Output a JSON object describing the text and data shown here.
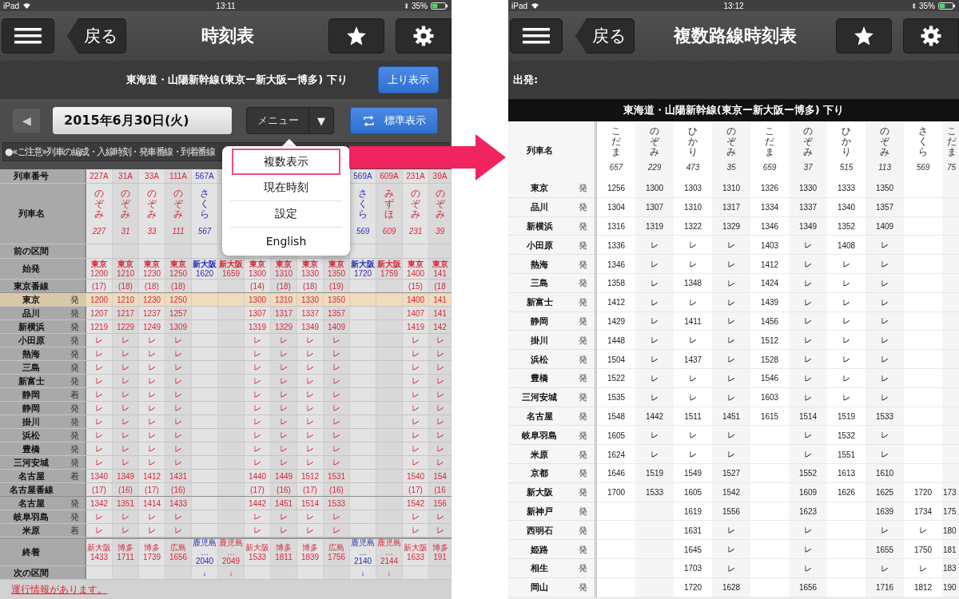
{
  "left_screen": {
    "status_bar": {
      "device": "iPad",
      "time": "13:11",
      "battery": "35%"
    },
    "nav": {
      "back": "戻る",
      "title": "時刻表"
    },
    "route_bar": {
      "title": "東海道・山陽新幹線(東京ー新大阪ー博多) 下り",
      "button": "上り表示"
    },
    "date_bar": {
      "prev": "◀",
      "date": "2015年6月30日(火)",
      "menu": "メニュー",
      "menu_caret": "▼",
      "view_button": "標準表示"
    },
    "notice": "●«ご注意»列車の編成・入線時刻・発車番線・到着番線",
    "menu_popup": {
      "items": [
        {
          "label": "複数表示",
          "selected": true
        },
        {
          "label": "現在時刻",
          "selected": false
        },
        {
          "label": "設定",
          "selected": false
        },
        {
          "label": "English",
          "selected": false
        }
      ]
    },
    "table": {
      "header_labels": {
        "number": "列車番号",
        "name": "列車名",
        "previous": "前の区間",
        "origin": "始発",
        "terminal": "終着",
        "next": "次の区間"
      },
      "rows": [
        {
          "label": "東京番線",
          "kind": "track",
          "highlight": false
        },
        {
          "label": "東京",
          "mark": "発",
          "kind": "stop",
          "highlight": true
        },
        {
          "label": "品川",
          "mark": "発",
          "kind": "stop",
          "highlight": false
        },
        {
          "label": "新横浜",
          "mark": "発",
          "kind": "stop",
          "highlight": false
        },
        {
          "label": "小田原",
          "mark": "発",
          "kind": "stop",
          "highlight": false
        },
        {
          "label": "熱海",
          "mark": "発",
          "kind": "stop",
          "highlight": false
        },
        {
          "label": "三島",
          "mark": "発",
          "kind": "stop",
          "highlight": false
        },
        {
          "label": "新富士",
          "mark": "発",
          "kind": "stop",
          "highlight": false
        },
        {
          "label": "静岡",
          "mark": "着",
          "kind": "stop",
          "highlight": false
        },
        {
          "label": "静岡",
          "mark": "発",
          "kind": "stop",
          "highlight": false
        },
        {
          "label": "掛川",
          "mark": "発",
          "kind": "stop",
          "highlight": false
        },
        {
          "label": "浜松",
          "mark": "発",
          "kind": "stop",
          "highlight": false
        },
        {
          "label": "豊橋",
          "mark": "発",
          "kind": "stop",
          "highlight": false
        },
        {
          "label": "三河安城",
          "mark": "発",
          "kind": "stop",
          "highlight": false
        },
        {
          "label": "名古屋",
          "mark": "着",
          "kind": "stop",
          "highlight": false
        },
        {
          "label": "名古屋番線",
          "kind": "track",
          "highlight": false
        },
        {
          "label": "名古屋",
          "mark": "発",
          "kind": "stop",
          "highlight": false
        },
        {
          "label": "岐阜羽島",
          "mark": "発",
          "kind": "stop",
          "highlight": false
        },
        {
          "label": "米原",
          "mark": "着",
          "kind": "stop",
          "highlight": false
        }
      ],
      "trains": [
        {
          "number": "227A",
          "name": "のぞみ",
          "name_number": "227",
          "color": "#d42a3c",
          "origin": "東京",
          "origin_time": "1200",
          "values": [
            "(17)",
            "1200",
            "1207",
            "1219",
            "レ",
            "レ",
            "レ",
            "レ",
            "レ",
            "レ",
            "レ",
            "レ",
            "レ",
            "レ",
            "1340",
            "(17)",
            "1342",
            "レ",
            "レ"
          ],
          "terminal": "新大阪",
          "terminal_time": "1433"
        },
        {
          "number": "31A",
          "name": "のぞみ",
          "name_number": "31",
          "color": "#d42a3c",
          "origin": "東京",
          "origin_time": "1210",
          "values": [
            "(18)",
            "1210",
            "1217",
            "1229",
            "レ",
            "レ",
            "レ",
            "レ",
            "レ",
            "レ",
            "レ",
            "レ",
            "レ",
            "レ",
            "1349",
            "(16)",
            "1351",
            "レ",
            "レ"
          ],
          "terminal": "博多",
          "terminal_time": "1711"
        },
        {
          "number": "33A",
          "name": "のぞみ",
          "name_number": "33",
          "color": "#d42a3c",
          "origin": "東京",
          "origin_time": "1230",
          "values": [
            "(18)",
            "1230",
            "1237",
            "1249",
            "レ",
            "レ",
            "レ",
            "レ",
            "レ",
            "レ",
            "レ",
            "レ",
            "レ",
            "レ",
            "1412",
            "(17)",
            "1414",
            "レ",
            "レ"
          ],
          "terminal": "博多",
          "terminal_time": "1739"
        },
        {
          "number": "111A",
          "name": "のぞみ",
          "name_number": "111",
          "color": "#d42a3c",
          "origin": "東京",
          "origin_time": "1250",
          "values": [
            "(18)",
            "1250",
            "1257",
            "1309",
            "レ",
            "レ",
            "レ",
            "レ",
            "レ",
            "レ",
            "レ",
            "レ",
            "レ",
            "レ",
            "1431",
            "(16)",
            "1433",
            "レ",
            "レ"
          ],
          "terminal": "広島",
          "terminal_time": "1656"
        },
        {
          "number": "567A",
          "name": "さくら",
          "name_number": "567",
          "color": "#2b2fb4",
          "origin": "新大阪",
          "origin_time": "1620",
          "terminal": "鹿児島…",
          "terminal_time": "2040",
          "next": "↓"
        },
        {
          "color": "#d42a3c",
          "origin": "新大阪",
          "origin_time": "1659",
          "terminal": "鹿児島…",
          "terminal_time": "2049",
          "next": "↓"
        },
        {
          "color": "#d42a3c",
          "origin": "東京",
          "origin_time": "1300",
          "values": [
            "(14)",
            "1300",
            "1307",
            "1319",
            "レ",
            "レ",
            "レ",
            "レ",
            "レ",
            "レ",
            "レ",
            "レ",
            "レ",
            "レ",
            "1440",
            "(17)",
            "1442",
            "レ",
            "レ"
          ],
          "terminal": "新大阪",
          "terminal_time": "1533"
        },
        {
          "color": "#d42a3c",
          "origin": "東京",
          "origin_time": "1310",
          "values": [
            "(18)",
            "1310",
            "1317",
            "1329",
            "レ",
            "レ",
            "レ",
            "レ",
            "レ",
            "レ",
            "レ",
            "レ",
            "レ",
            "レ",
            "1449",
            "(16)",
            "1451",
            "レ",
            "レ"
          ],
          "terminal": "博多",
          "terminal_time": "1811"
        },
        {
          "color": "#d42a3c",
          "origin": "東京",
          "origin_time": "1330",
          "values": [
            "(18)",
            "1330",
            "1337",
            "1349",
            "レ",
            "レ",
            "レ",
            "レ",
            "レ",
            "レ",
            "レ",
            "レ",
            "レ",
            "レ",
            "1512",
            "(17)",
            "1514",
            "レ",
            "レ"
          ],
          "terminal": "博多",
          "terminal_time": "1839"
        },
        {
          "color": "#d42a3c",
          "origin": "東京",
          "origin_time": "1350",
          "values": [
            "(19)",
            "1350",
            "1357",
            "1409",
            "レ",
            "レ",
            "レ",
            "レ",
            "レ",
            "レ",
            "レ",
            "レ",
            "レ",
            "レ",
            "1531",
            "(16)",
            "1533",
            "レ",
            "レ"
          ],
          "terminal": "広島",
          "terminal_time": "1756"
        },
        {
          "number": "569A",
          "name": "さくら",
          "name_number": "569",
          "color": "#2b2fb4",
          "origin": "新大阪",
          "origin_time": "1720",
          "terminal": "鹿児島…",
          "terminal_time": "2140",
          "next": "↓"
        },
        {
          "number": "609A",
          "name": "みずほ",
          "name_number": "609",
          "color": "#d42a3c",
          "origin": "新大阪",
          "origin_time": "1759",
          "terminal": "鹿児島…",
          "terminal_time": "2144",
          "next": "↓"
        },
        {
          "number": "231A",
          "name": "のぞみ",
          "name_number": "231",
          "color": "#d42a3c",
          "origin": "東京",
          "origin_time": "1400",
          "values": [
            "(15)",
            "1400",
            "1407",
            "1419",
            "レ",
            "レ",
            "レ",
            "レ",
            "レ",
            "レ",
            "レ",
            "レ",
            "レ",
            "レ",
            "1540",
            "(17)",
            "1542",
            "レ",
            "レ"
          ],
          "terminal": "新大阪",
          "terminal_time": "1633"
        },
        {
          "number": "39A",
          "name": "のぞみ",
          "name_number": "39",
          "color": "#d42a3c",
          "origin": "東京",
          "origin_time": "141",
          "values": [
            "(18",
            "141",
            "141",
            "142",
            "レ",
            "レ",
            "レ",
            "レ",
            "レ",
            "レ",
            "レ",
            "レ",
            "レ",
            "レ",
            "154",
            "(16",
            "156",
            "レ",
            "レ"
          ],
          "terminal": "博多",
          "terminal_time": "191"
        }
      ]
    },
    "footer_link": "運行情報があります。"
  },
  "right_screen": {
    "status_bar": {
      "device": "iPad",
      "time": "13:12",
      "battery": "35%"
    },
    "nav": {
      "back": "戻る",
      "title": "複数路線時刻表"
    },
    "departure_label": "出発:",
    "route_title": "東海道・山陽新幹線(東京ー新大阪ー博多) 下り",
    "table": {
      "name_label": "列車名",
      "stations": [
        {
          "label": "東京",
          "mark": "発"
        },
        {
          "label": "品川",
          "mark": "発"
        },
        {
          "label": "新横浜",
          "mark": "発"
        },
        {
          "label": "小田原",
          "mark": "発"
        },
        {
          "label": "熱海",
          "mark": "発"
        },
        {
          "label": "三島",
          "mark": "発"
        },
        {
          "label": "新富士",
          "mark": "発"
        },
        {
          "label": "静岡",
          "mark": "発"
        },
        {
          "label": "掛川",
          "mark": "発"
        },
        {
          "label": "浜松",
          "mark": "発"
        },
        {
          "label": "豊橋",
          "mark": "発"
        },
        {
          "label": "三河安城",
          "mark": "発"
        },
        {
          "label": "名古屋",
          "mark": "発"
        },
        {
          "label": "岐阜羽島",
          "mark": "発"
        },
        {
          "label": "米原",
          "mark": "発"
        },
        {
          "label": "京都",
          "mark": "発"
        },
        {
          "label": "新大阪",
          "mark": "発"
        },
        {
          "label": "新神戸",
          "mark": "発"
        },
        {
          "label": "西明石",
          "mark": "発"
        },
        {
          "label": "姫路",
          "mark": "発"
        },
        {
          "label": "相生",
          "mark": "発"
        },
        {
          "label": "岡山",
          "mark": "発"
        }
      ],
      "trains": [
        {
          "name": "こだま",
          "number": "657",
          "from_bottom": false,
          "values": [
            "1256",
            "1304",
            "1316",
            "1336",
            "1346",
            "1358",
            "1412",
            "1429",
            "1448",
            "1504",
            "1522",
            "1535",
            "1548",
            "1605",
            "1624",
            "1646",
            "1700"
          ]
        },
        {
          "name": "のぞみ",
          "number": "229",
          "from_bottom": false,
          "values": [
            "1300",
            "1307",
            "1319",
            "レ",
            "レ",
            "レ",
            "レ",
            "レ",
            "レ",
            "レ",
            "レ",
            "レ",
            "1442",
            "レ",
            "レ",
            "1519",
            "1533"
          ]
        },
        {
          "name": "ひかり",
          "number": "473",
          "values": [
            "1303",
            "1310",
            "1322",
            "レ",
            "レ",
            "1348",
            "レ",
            "1411",
            "レ",
            "1437",
            "レ",
            "レ",
            "1511",
            "レ",
            "レ",
            "1549",
            "1605",
            "1619",
            "1631",
            "1645",
            "1703",
            "1720"
          ]
        },
        {
          "name": "のぞみ",
          "number": "35",
          "values": [
            "1310",
            "1317",
            "1329",
            "レ",
            "レ",
            "レ",
            "レ",
            "レ",
            "レ",
            "レ",
            "レ",
            "レ",
            "1451",
            "レ",
            "レ",
            "1527",
            "1542",
            "1556",
            "レ",
            "レ",
            "レ",
            "1628"
          ]
        },
        {
          "name": "こだま",
          "number": "659",
          "from_bottom": false,
          "values": [
            "1326",
            "1334",
            "1346",
            "1403",
            "1412",
            "1424",
            "1439",
            "1456",
            "1512",
            "1528",
            "1546",
            "1603",
            "1615"
          ]
        },
        {
          "name": "のぞみ",
          "number": "37",
          "values": [
            "1330",
            "1337",
            "1349",
            "レ",
            "レ",
            "レ",
            "レ",
            "レ",
            "レ",
            "レ",
            "レ",
            "レ",
            "1514",
            "レ",
            "レ",
            "1552",
            "1609",
            "1623",
            "レ",
            "レ",
            "レ",
            "1656"
          ]
        },
        {
          "name": "ひかり",
          "number": "515",
          "from_bottom": false,
          "values": [
            "1333",
            "1340",
            "1352",
            "1408",
            "レ",
            "レ",
            "レ",
            "レ",
            "レ",
            "レ",
            "レ",
            "レ",
            "1519",
            "1532",
            "1551",
            "1613",
            "1626"
          ]
        },
        {
          "name": "のぞみ",
          "number": "113",
          "values": [
            "1350",
            "1357",
            "1409",
            "レ",
            "レ",
            "レ",
            "レ",
            "レ",
            "レ",
            "レ",
            "レ",
            "レ",
            "1533",
            "レ",
            "レ",
            "1610",
            "1625",
            "1639",
            "レ",
            "1655",
            "レ",
            "1716"
          ]
        },
        {
          "name": "さくら",
          "number": "569",
          "from_bottom": true,
          "values": [
            "1720",
            "1734",
            "レ",
            "1750",
            "レ",
            "1812"
          ]
        },
        {
          "name": "こだま",
          "number": "75",
          "from_bottom": true,
          "values": [
            "173",
            "175",
            "180",
            "181",
            "183",
            "190"
          ]
        }
      ]
    }
  }
}
